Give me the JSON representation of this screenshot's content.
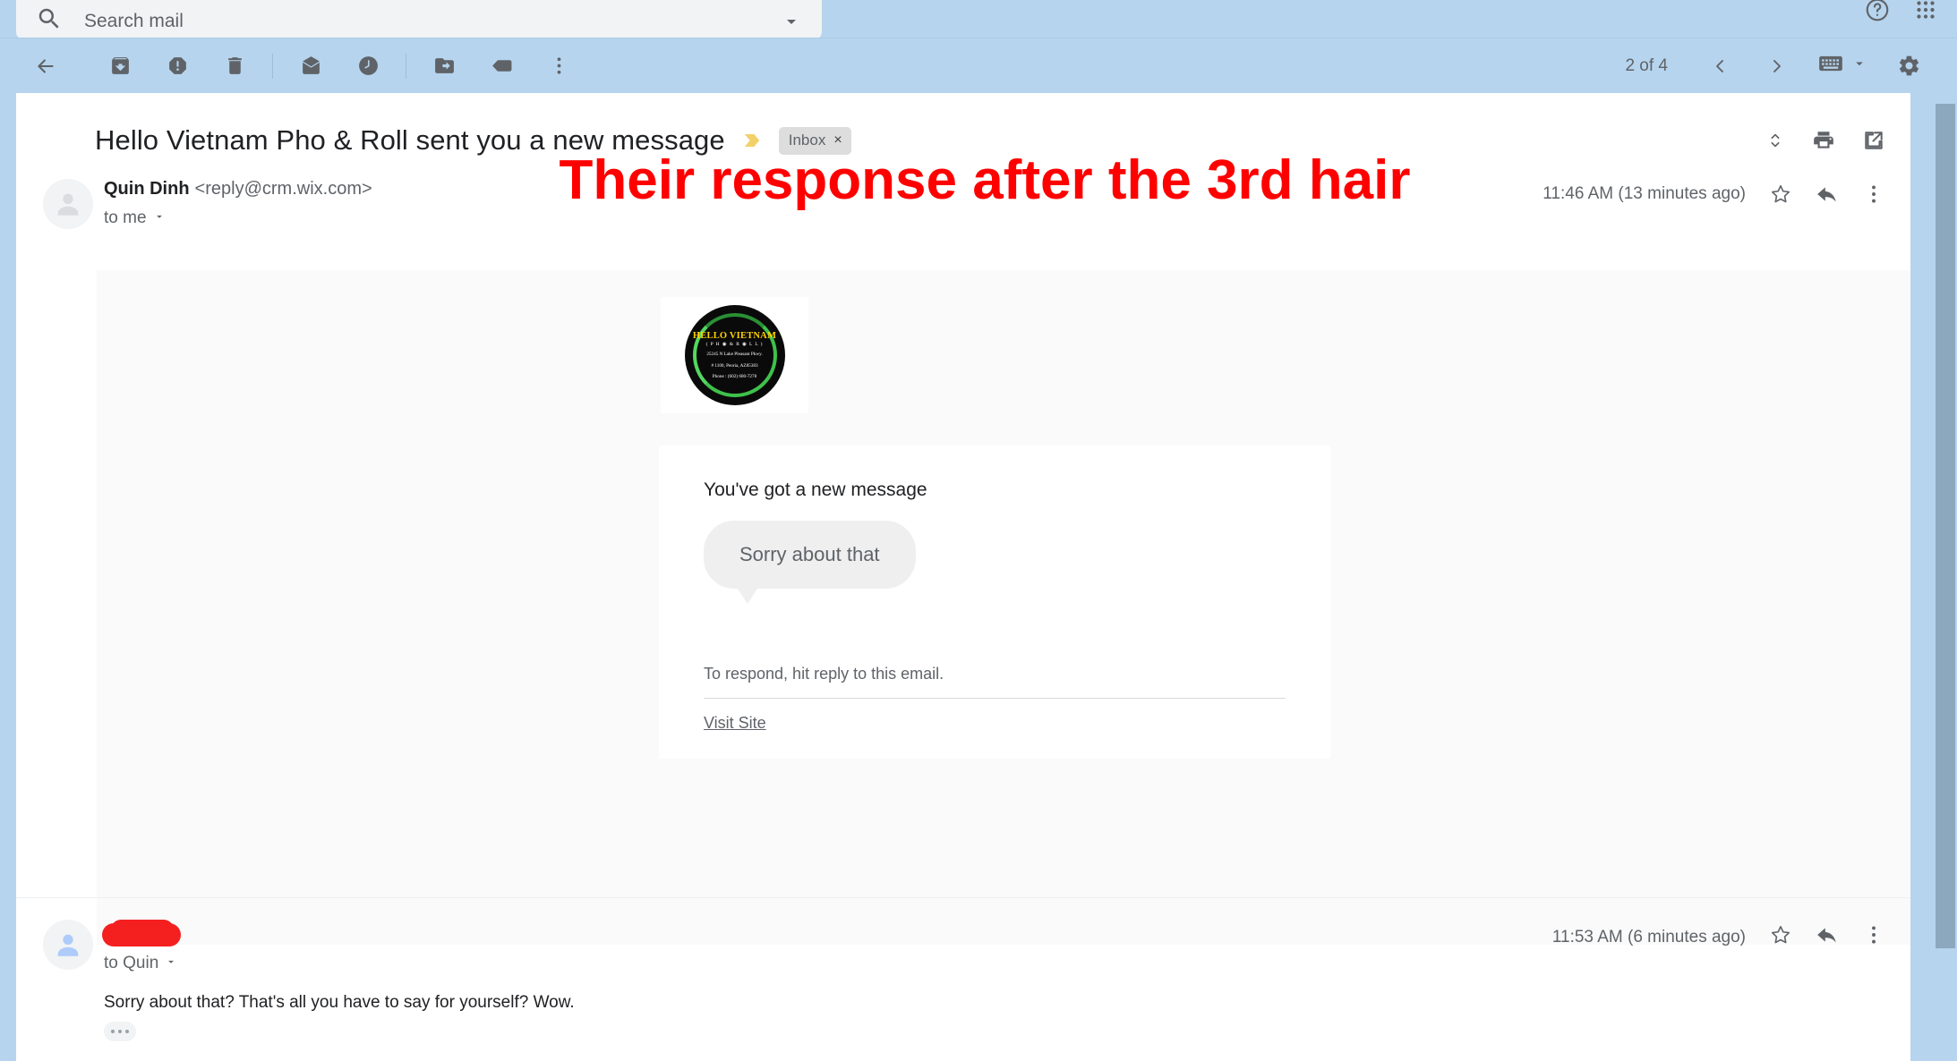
{
  "search": {
    "placeholder": "Search mail",
    "value": "",
    "icon": "search-icon",
    "dropdown_icon": "chevron-down-icon"
  },
  "header_right": {
    "help_icon": "help-circle-icon",
    "apps_icon": "apps-grid-icon"
  },
  "toolbar": {
    "back_icon": "back-arrow-icon",
    "archive_icon": "archive-icon",
    "spam_icon": "report-spam-icon",
    "delete_icon": "trash-icon",
    "mark_unread_icon": "mark-as-unread-icon",
    "snooze_icon": "snooze-clock-icon",
    "move_to_icon": "move-to-folder-icon",
    "labels_icon": "label-tag-icon",
    "more_icon": "more-vertical-icon",
    "count": "2 of 4",
    "prev_icon": "chevron-left-icon",
    "next_icon": "chevron-right-icon",
    "keyboard_icon": "keyboard-icon",
    "keyboard_caret_icon": "chevron-down-icon",
    "settings_icon": "gear-icon"
  },
  "thread": {
    "subject": "Hello Vietnam Pho & Roll sent you a new message",
    "importance_icon": "importance-marker-icon",
    "label_chip": "Inbox",
    "label_chip_remove": "×",
    "expand_icon": "expand-collapse-icon",
    "print_icon": "print-icon",
    "popout_icon": "open-in-new-window-icon"
  },
  "messages": [
    {
      "avatar_icon": "person-avatar-icon",
      "sender_name": "Quin Dinh",
      "sender_address": "<reply@crm.wix.com>",
      "recipient": "to me",
      "recipient_caret_icon": "chevron-down-icon",
      "timestamp": "11:46 AM (13 minutes ago)",
      "star_icon": "star-outline-icon",
      "reply_icon": "reply-arrow-icon",
      "more_icon": "more-vertical-icon"
    },
    {
      "avatar_icon": "person-avatar-icon",
      "sender_name": "",
      "recipient": "to Quin",
      "recipient_caret_icon": "chevron-down-icon",
      "timestamp": "11:53 AM (6 minutes ago)",
      "body": "Sorry about that? That's all you have to say for yourself? Wow.",
      "trimmed_content_icon": "show-trimmed-content-icon",
      "star_icon": "star-outline-icon",
      "reply_icon": "reply-arrow-icon",
      "more_icon": "more-vertical-icon"
    }
  ],
  "annotation": {
    "text": "Their response after the 3rd hair",
    "color": "#ff0000"
  },
  "email_content": {
    "logo": {
      "title": "HELLO VIETNAM",
      "subtitle": "( P H ◉ & R ◉ L L )",
      "address_line1": "25245 N Lake Pleasant Pkwy.",
      "address_line2": "# 1100, Peoria, AZ85383",
      "phone": "Phone : (602) 600-7278"
    },
    "card_title": "You've got a new message",
    "bubble_text": "Sorry about that",
    "respond_note": "To respond, hit reply to this email.",
    "visit_link": "Visit Site"
  },
  "colors": {
    "chrome_blue": "#b6d4ed",
    "accent_red": "#ff0000",
    "body_gray": "#fafafa",
    "chip_gray": "#ddddde"
  }
}
